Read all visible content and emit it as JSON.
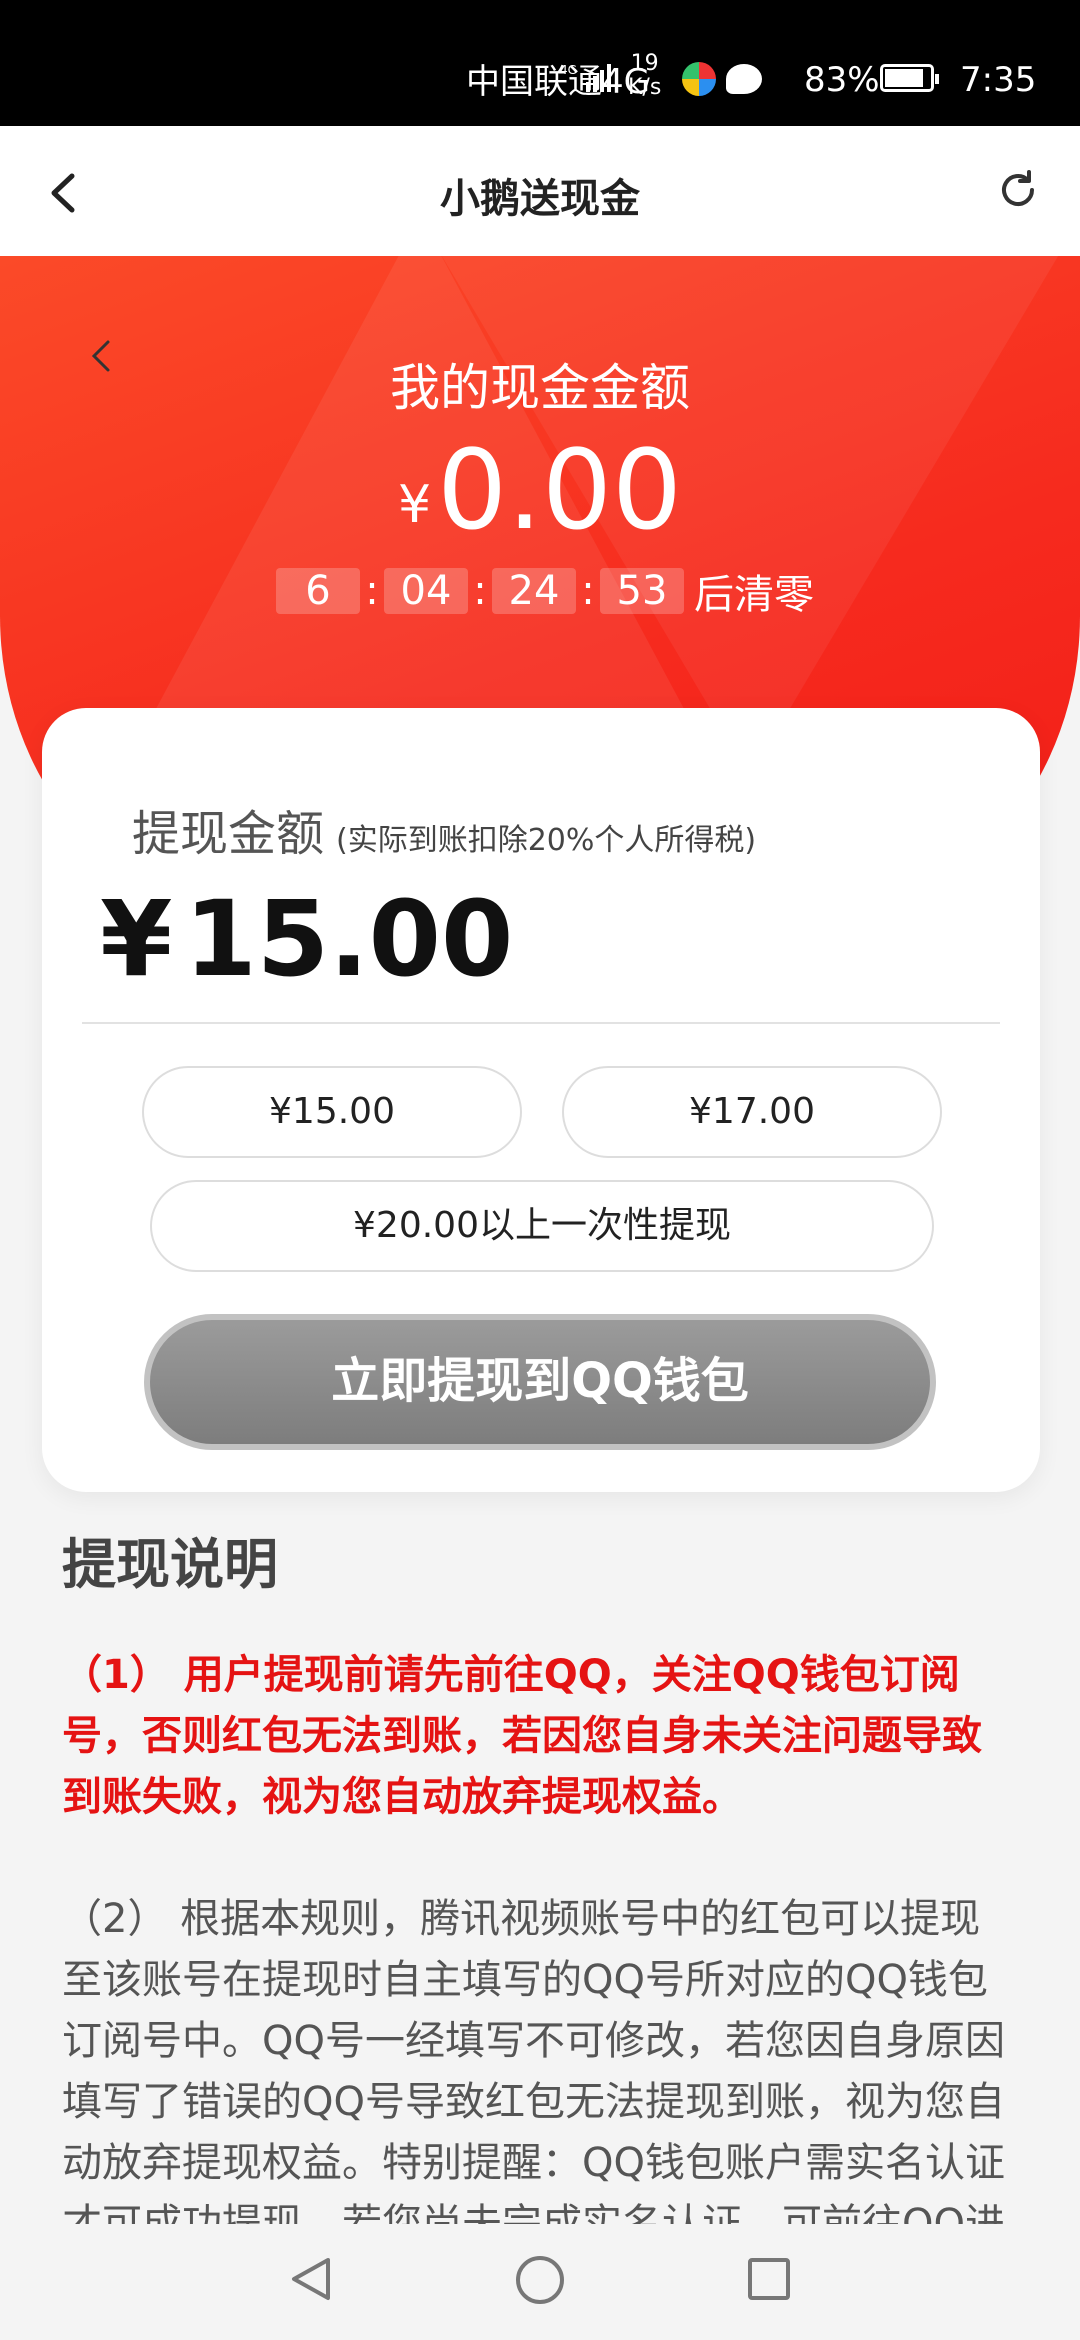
{
  "status_bar": {
    "carrier": "中国联通4G",
    "speed_value": "19",
    "speed_unit": "K/s",
    "battery": "83%",
    "time": "7:35"
  },
  "nav": {
    "title": "小鹅送现金",
    "back_icon": "chevron-left-icon",
    "refresh_icon": "refresh-icon"
  },
  "hero": {
    "label": "我的现金金额",
    "currency": "¥",
    "amount": "0.00",
    "countdown": {
      "days": "6",
      "hours": "04",
      "minutes": "24",
      "seconds": "53",
      "sep": ":",
      "suffix": "后清零"
    }
  },
  "withdraw": {
    "label": "提现金额",
    "note": "(实际到账扣除20%个人所得税)",
    "currency": "¥",
    "amount": "15.00",
    "options": [
      "¥15.00",
      "¥17.00",
      "¥20.00以上一次性提现"
    ],
    "cta": "立即提现到QQ钱包"
  },
  "rules": {
    "heading": "提现说明",
    "rule1": "（1） 用户提现前请先前往QQ，关注QQ钱包订阅号，否则红包无法到账，若因您自身未关注问题导致到账失败，视为您自动放弃提现权益。",
    "rule2": "（2） 根据本规则，腾讯视频账号中的红包可以提现至该账号在提现时自主填写的QQ号所对应的QQ钱包订阅号中。QQ号一经填写不可修改，若您因自身原因填写了错误的QQ号导致红包无法提现到账，视为您自动放弃提现权益。特别提醒：QQ钱包账户需实名认证才可成功提现，若您尚未完成实名认证，可前往QQ进"
  },
  "colors": {
    "hero_red": "#f62a1e",
    "rule_red": "#e51313",
    "cta_gray": "#8a8a8a"
  }
}
